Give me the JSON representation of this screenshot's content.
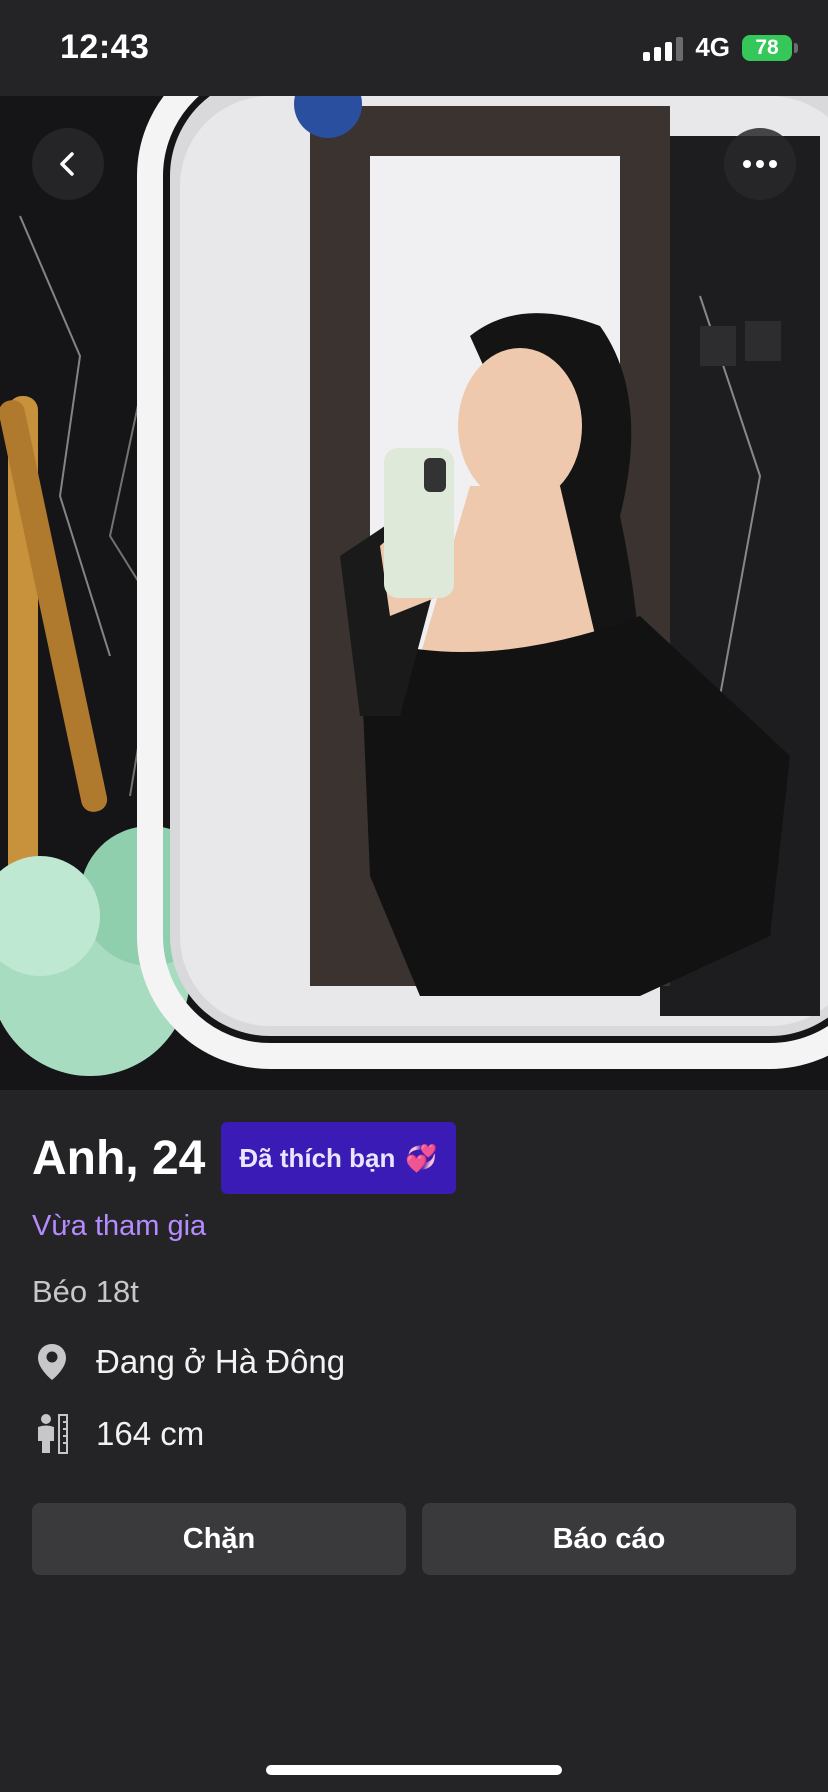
{
  "status_bar": {
    "time": "12:43",
    "network": "4G",
    "battery": "78"
  },
  "profile": {
    "name_age": "Anh, 24",
    "liked_badge": "Đã thích bạn",
    "liked_emoji": "💞",
    "joined_label": "Vừa tham gia",
    "bio": "Béo 18t",
    "location": "Đang ở Hà Đông",
    "height": "164 cm"
  },
  "actions": {
    "block_label": "Chặn",
    "report_label": "Báo cáo"
  },
  "icons": {
    "back": "chevron-left-icon",
    "more": "more-horizontal-icon",
    "location": "location-pin-icon",
    "height": "person-height-icon"
  },
  "colors": {
    "background": "#242426",
    "badge": "#3a1bb5",
    "joined": "#b58bff",
    "button": "#3a3a3d"
  }
}
